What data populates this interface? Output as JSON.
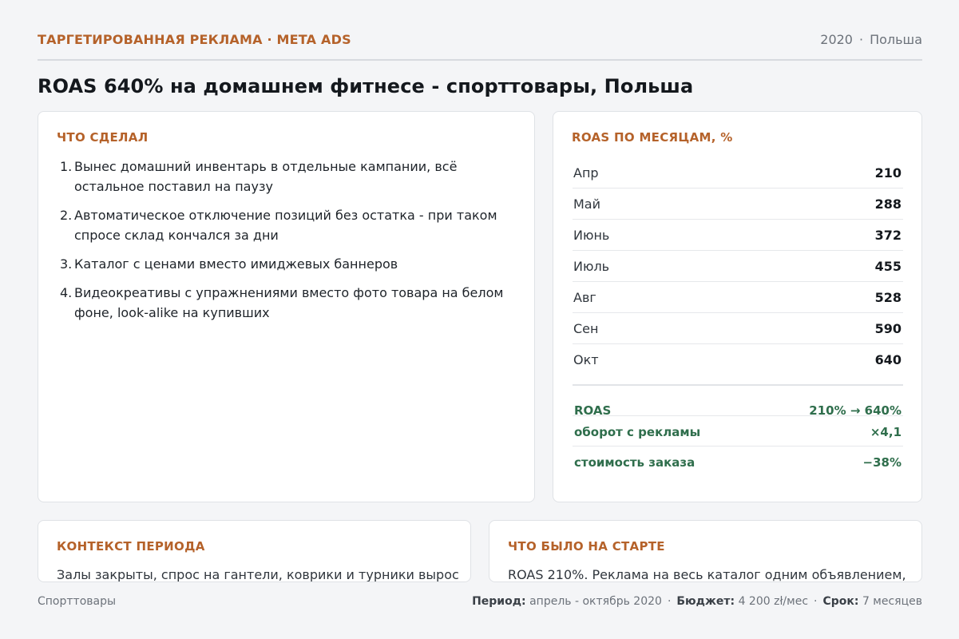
{
  "header": {
    "kicker": "ТАРГЕТИРОВАННАЯ РЕКЛАМА · META ADS",
    "year": "2020",
    "separator": "·",
    "country": "Польша"
  },
  "title": "ROAS 640% на домашнем фитнесе - спорттовары, Польша",
  "done": {
    "title": "ЧТО СДЕЛАЛ",
    "items": [
      {
        "num": "1.",
        "text": "Вынес домашний инвентарь в отдельные кампании, всё остальное поставил на паузу"
      },
      {
        "num": "2.",
        "text": "Автоматическое отключение позиций без остатка - при таком спросе склад кончался за дни"
      },
      {
        "num": "3.",
        "text": "Каталог с ценами вместо имиджевых баннеров"
      },
      {
        "num": "4.",
        "text": "Видеокреативы с упражнениями вместо фото товара на белом фоне, look-alike на купивших"
      }
    ]
  },
  "roas": {
    "title": "ROAS ПО МЕСЯЦАМ, %",
    "months": [
      {
        "month": "Апр",
        "value": "210"
      },
      {
        "month": "Май",
        "value": "288"
      },
      {
        "month": "Июнь",
        "value": "372"
      },
      {
        "month": "Июль",
        "value": "455"
      },
      {
        "month": "Авг",
        "value": "528"
      },
      {
        "month": "Сен",
        "value": "590"
      },
      {
        "month": "Окт",
        "value": "640"
      }
    ],
    "summary": [
      {
        "key": "ROAS",
        "value": "210% → 640%"
      },
      {
        "key": "оборот с рекламы",
        "value": "×4,1"
      },
      {
        "key": "стоимость заказа",
        "value": "−38%"
      }
    ]
  },
  "context": {
    "title": "КОНТЕКСТ ПЕРИОДА",
    "text": "Залы закрыты, спрос на гантели, коврики и турники вырос"
  },
  "start": {
    "title": "ЧТО БЫЛО НА СТАРТЕ",
    "text": "ROAS 210%. Реклама на весь каталог одним объявлением,"
  },
  "footer": {
    "category": "Спорттовары",
    "period_label": "Период:",
    "period_value": "апрель - октябрь 2020",
    "budget_label": "Бюджет:",
    "budget_value": "4 200 zł/мес",
    "term_label": "Срок:",
    "term_value": "7 месяцев",
    "separator": "·"
  },
  "colors": {
    "accent": "#b5622a",
    "positive": "#2f6e4c",
    "background": "#f4f5f7"
  }
}
